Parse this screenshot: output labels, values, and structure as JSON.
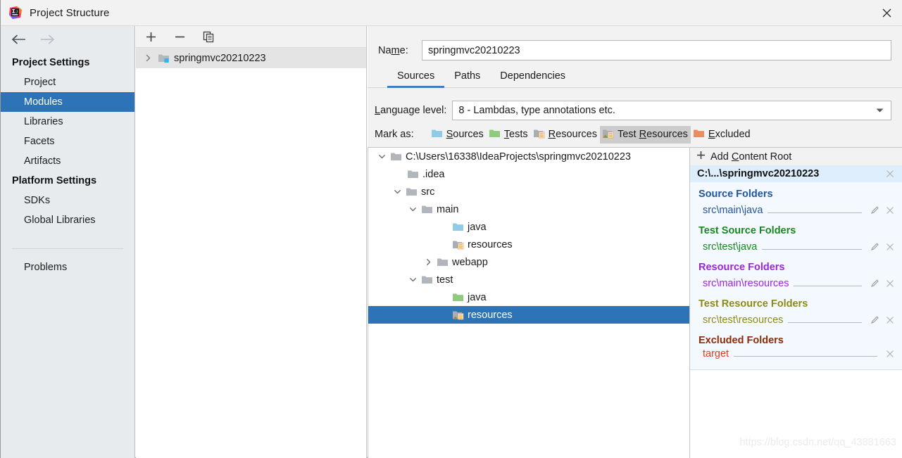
{
  "window": {
    "title": "Project Structure",
    "logo_icon": "intellij-idea-logo",
    "close_icon": "close-icon"
  },
  "sidebar": {
    "back_icon": "arrow-left-icon",
    "forward_icon": "arrow-right-icon",
    "groups": [
      {
        "title": "Project Settings",
        "items": [
          {
            "label": "Project",
            "selected": false
          },
          {
            "label": "Modules",
            "selected": true
          },
          {
            "label": "Libraries",
            "selected": false
          },
          {
            "label": "Facets",
            "selected": false
          },
          {
            "label": "Artifacts",
            "selected": false
          }
        ]
      },
      {
        "title": "Platform Settings",
        "items": [
          {
            "label": "SDKs",
            "selected": false
          },
          {
            "label": "Global Libraries",
            "selected": false
          }
        ]
      }
    ],
    "problems_label": "Problems"
  },
  "modules_panel": {
    "toolbar": {
      "add_icon": "plus-icon",
      "remove_icon": "minus-icon",
      "copy_icon": "copy-icon"
    },
    "module": {
      "name": "springmvc20210223",
      "expand_icon": "chevron-right-icon",
      "folder_icon": "module-folder-icon",
      "selected": true
    }
  },
  "main": {
    "name_field": {
      "label_pre": "Na",
      "label_mnemonic": "m",
      "label_post": "e:",
      "value": "springmvc20210223"
    },
    "tabs": [
      {
        "label": "Sources",
        "active": true
      },
      {
        "label": "Paths",
        "active": false
      },
      {
        "label": "Dependencies",
        "active": false
      }
    ],
    "language_level": {
      "label_pre": "",
      "label_mnemonic": "L",
      "label_post": "anguage level:",
      "value": "8 - Lambdas, type annotations etc.",
      "dropdown_icon": "chevron-down-icon"
    },
    "mark_as": {
      "label": "Mark as:",
      "options": [
        {
          "pre": "",
          "mnemonic": "S",
          "post": "ources",
          "icon": "folder-sources-icon",
          "color": "#8cc8e8",
          "pressed": false
        },
        {
          "pre": "",
          "mnemonic": "T",
          "post": "ests",
          "icon": "folder-tests-icon",
          "color": "#8dca78",
          "pressed": false
        },
        {
          "pre": "",
          "mnemonic": "R",
          "post": "esources",
          "icon": "folder-resources-icon",
          "color": "#a3a7ab",
          "pressed": false
        },
        {
          "pre": "Test ",
          "mnemonic": "R",
          "post": "esources",
          "icon": "folder-test-resources-icon",
          "color": "#a3a7ab",
          "pressed": true
        },
        {
          "pre": "",
          "mnemonic": "E",
          "post": "xcluded",
          "icon": "folder-excluded-icon",
          "color": "#e8865c",
          "pressed": false
        }
      ]
    },
    "file_tree": [
      {
        "label": "C:\\Users\\16338\\IdeaProjects\\springmvc20210223",
        "depth": 0,
        "twisty": "expanded",
        "icon": "folder-plain-icon",
        "selected": false
      },
      {
        "label": ".idea",
        "depth": 1,
        "twisty": "none",
        "icon": "folder-plain-icon",
        "selected": false
      },
      {
        "label": "src",
        "depth": 1,
        "twisty": "expanded",
        "icon": "folder-plain-icon",
        "selected": false
      },
      {
        "label": "main",
        "depth": 2,
        "twisty": "expanded",
        "icon": "folder-plain-icon",
        "selected": false
      },
      {
        "label": "java",
        "depth": 3,
        "twisty": "none",
        "icon": "folder-sources-icon",
        "selected": false
      },
      {
        "label": "resources",
        "depth": 3,
        "twisty": "none",
        "icon": "folder-resources-icon",
        "selected": false
      },
      {
        "label": "webapp",
        "depth": 3,
        "twisty": "collapsed",
        "icon": "folder-plain-icon",
        "selected": false
      },
      {
        "label": "test",
        "depth": 2,
        "twisty": "expanded",
        "icon": "folder-plain-icon",
        "selected": false
      },
      {
        "label": "java",
        "depth": 3,
        "twisty": "none",
        "icon": "folder-tests-icon",
        "selected": false
      },
      {
        "label": "resources",
        "depth": 3,
        "twisty": "none",
        "icon": "folder-test-resources-icon",
        "selected": true
      }
    ],
    "content_roots": {
      "add_content_root": {
        "pre": "Add ",
        "mnemonic": "C",
        "post": "ontent Root",
        "icon": "plus-icon"
      },
      "root_header": {
        "label": "C:\\...\\springmvc20210223",
        "remove_icon": "close-small-icon"
      },
      "groups": [
        {
          "title": "Source Folders",
          "color": "#225599",
          "entries": [
            {
              "path": "src\\main\\java",
              "edit_icon": "pencil-icon",
              "remove_icon": "close-small-icon",
              "has_edit": true
            }
          ]
        },
        {
          "title": "Test Source Folders",
          "color": "#16881f",
          "entries": [
            {
              "path": "src\\test\\java",
              "edit_icon": "pencil-icon",
              "remove_icon": "close-small-icon",
              "has_edit": true
            }
          ]
        },
        {
          "title": "Resource Folders",
          "color": "#9c27d4",
          "entries": [
            {
              "path": "src\\main\\resources",
              "edit_icon": "pencil-icon",
              "remove_icon": "close-small-icon",
              "has_edit": true
            }
          ]
        },
        {
          "title": "Test Resource Folders",
          "color": "#8a8c11",
          "entries": [
            {
              "path": "src\\test\\resources",
              "edit_icon": "pencil-icon",
              "remove_icon": "close-small-icon",
              "has_edit": true
            }
          ]
        },
        {
          "title": "Excluded Folders",
          "color": "#8c2b06",
          "entries": [
            {
              "path": "target",
              "edit_icon": "",
              "remove_icon": "close-small-icon",
              "has_edit": false
            }
          ]
        }
      ]
    },
    "watermark": "https://blog.csdn.net/qq_43881663"
  }
}
